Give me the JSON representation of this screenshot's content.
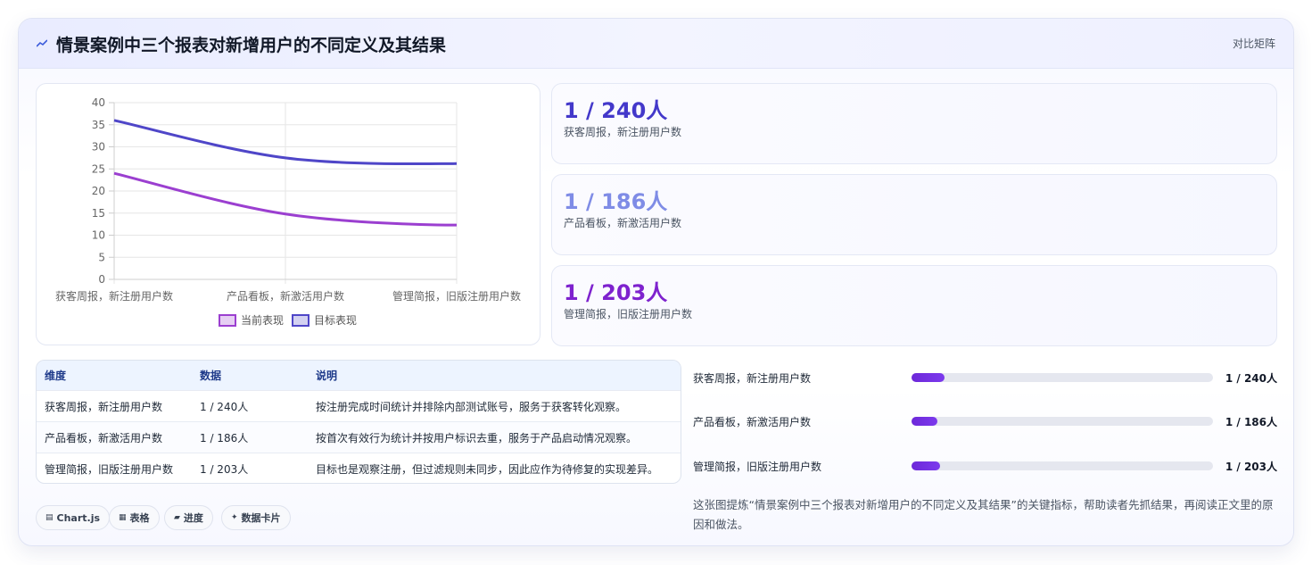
{
  "header": {
    "title": "情景案例中三个报表对新增用户的不同定义及其结果",
    "action_label": "对比矩阵",
    "icon": "trend-line-icon"
  },
  "chart_data": {
    "type": "line",
    "categories": [
      "获客周报，新注册用户数",
      "产品看板，新激活用户数",
      "管理简报，旧版注册用户数"
    ],
    "series": [
      {
        "name": "当前表现",
        "color": "#9b3fd0",
        "values": [
          24,
          14.8,
          12.3
        ]
      },
      {
        "name": "目标表现",
        "color": "#4f46c8",
        "values": [
          36,
          27.5,
          26.2
        ]
      }
    ],
    "ylim": [
      0,
      40
    ],
    "yticks": [
      0,
      5,
      10,
      15,
      20,
      25,
      30,
      35,
      40
    ],
    "legend": "bottom",
    "grid": true
  },
  "stats": [
    {
      "value": "1 / 240人",
      "label": "获客周报，新注册用户数",
      "color": "#4338ca"
    },
    {
      "value": "1 / 186人",
      "label": "产品看板，新激活用户数",
      "color": "#7f8ce6"
    },
    {
      "value": "1 / 203人",
      "label": "管理简报，旧版注册用户数",
      "color": "#7e22ce"
    }
  ],
  "table": {
    "headers": [
      "维度",
      "数据",
      "说明"
    ],
    "rows": [
      [
        "获客周报，新注册用户数",
        "1 / 240人",
        "按注册完成时间统计并排除内部测试账号，服务于获客转化观察。"
      ],
      [
        "产品看板，新激活用户数",
        "1 / 186人",
        "按首次有效行为统计并按用户标识去重，服务于产品启动情况观察。"
      ],
      [
        "管理简报，旧版注册用户数",
        "1 / 203人",
        "目标也是观察注册，但过滤规则未同步，因此应作为待修复的实现差异。"
      ]
    ]
  },
  "chips": [
    {
      "icon": "▤",
      "label": "Chart.js"
    },
    {
      "icon": "▦",
      "label": "表格"
    },
    {
      "icon": "▰",
      "label": "进度"
    },
    {
      "icon": "✦",
      "label": "数据卡片"
    }
  ],
  "progress": [
    {
      "label": "获客周报，新注册用户数",
      "value": "1 / 240人",
      "fraction": 0.11
    },
    {
      "label": "产品看板，新激活用户数",
      "value": "1 / 186人",
      "fraction": 0.085
    },
    {
      "label": "管理简报，旧版注册用户数",
      "value": "1 / 203人",
      "fraction": 0.095
    }
  ],
  "summary": "这张图提炼“情景案例中三个报表对新增用户的不同定义及其结果”的关键指标，帮助读者先抓结果，再阅读正文里的原因和做法。"
}
